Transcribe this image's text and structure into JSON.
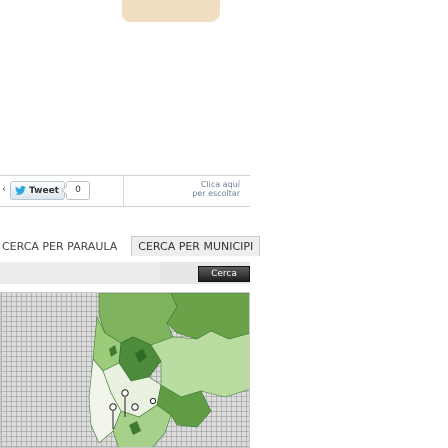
{
  "banner": {
    "text": ""
  },
  "social": {
    "left_edge": "‹",
    "tweet_label": "Tweet",
    "tweet_count": "0",
    "click_hint_line1": "Clica aquí",
    "click_hint_line2": "per escoltar",
    "bird_icon": "twitter-bird-icon"
  },
  "tabs": [
    {
      "label": "CERCA PER PARAULA",
      "active": false
    },
    {
      "label": "CERCA PER MUNICIPI",
      "active": true
    }
  ],
  "search": {
    "button_label": "Cerca"
  },
  "colors": {
    "map_green_dark": "#3f7a33",
    "map_green_light": "#8fbf6a",
    "map_background": "#dcdcdc",
    "marker": "#ffffff",
    "marker_outline": "#222222"
  }
}
